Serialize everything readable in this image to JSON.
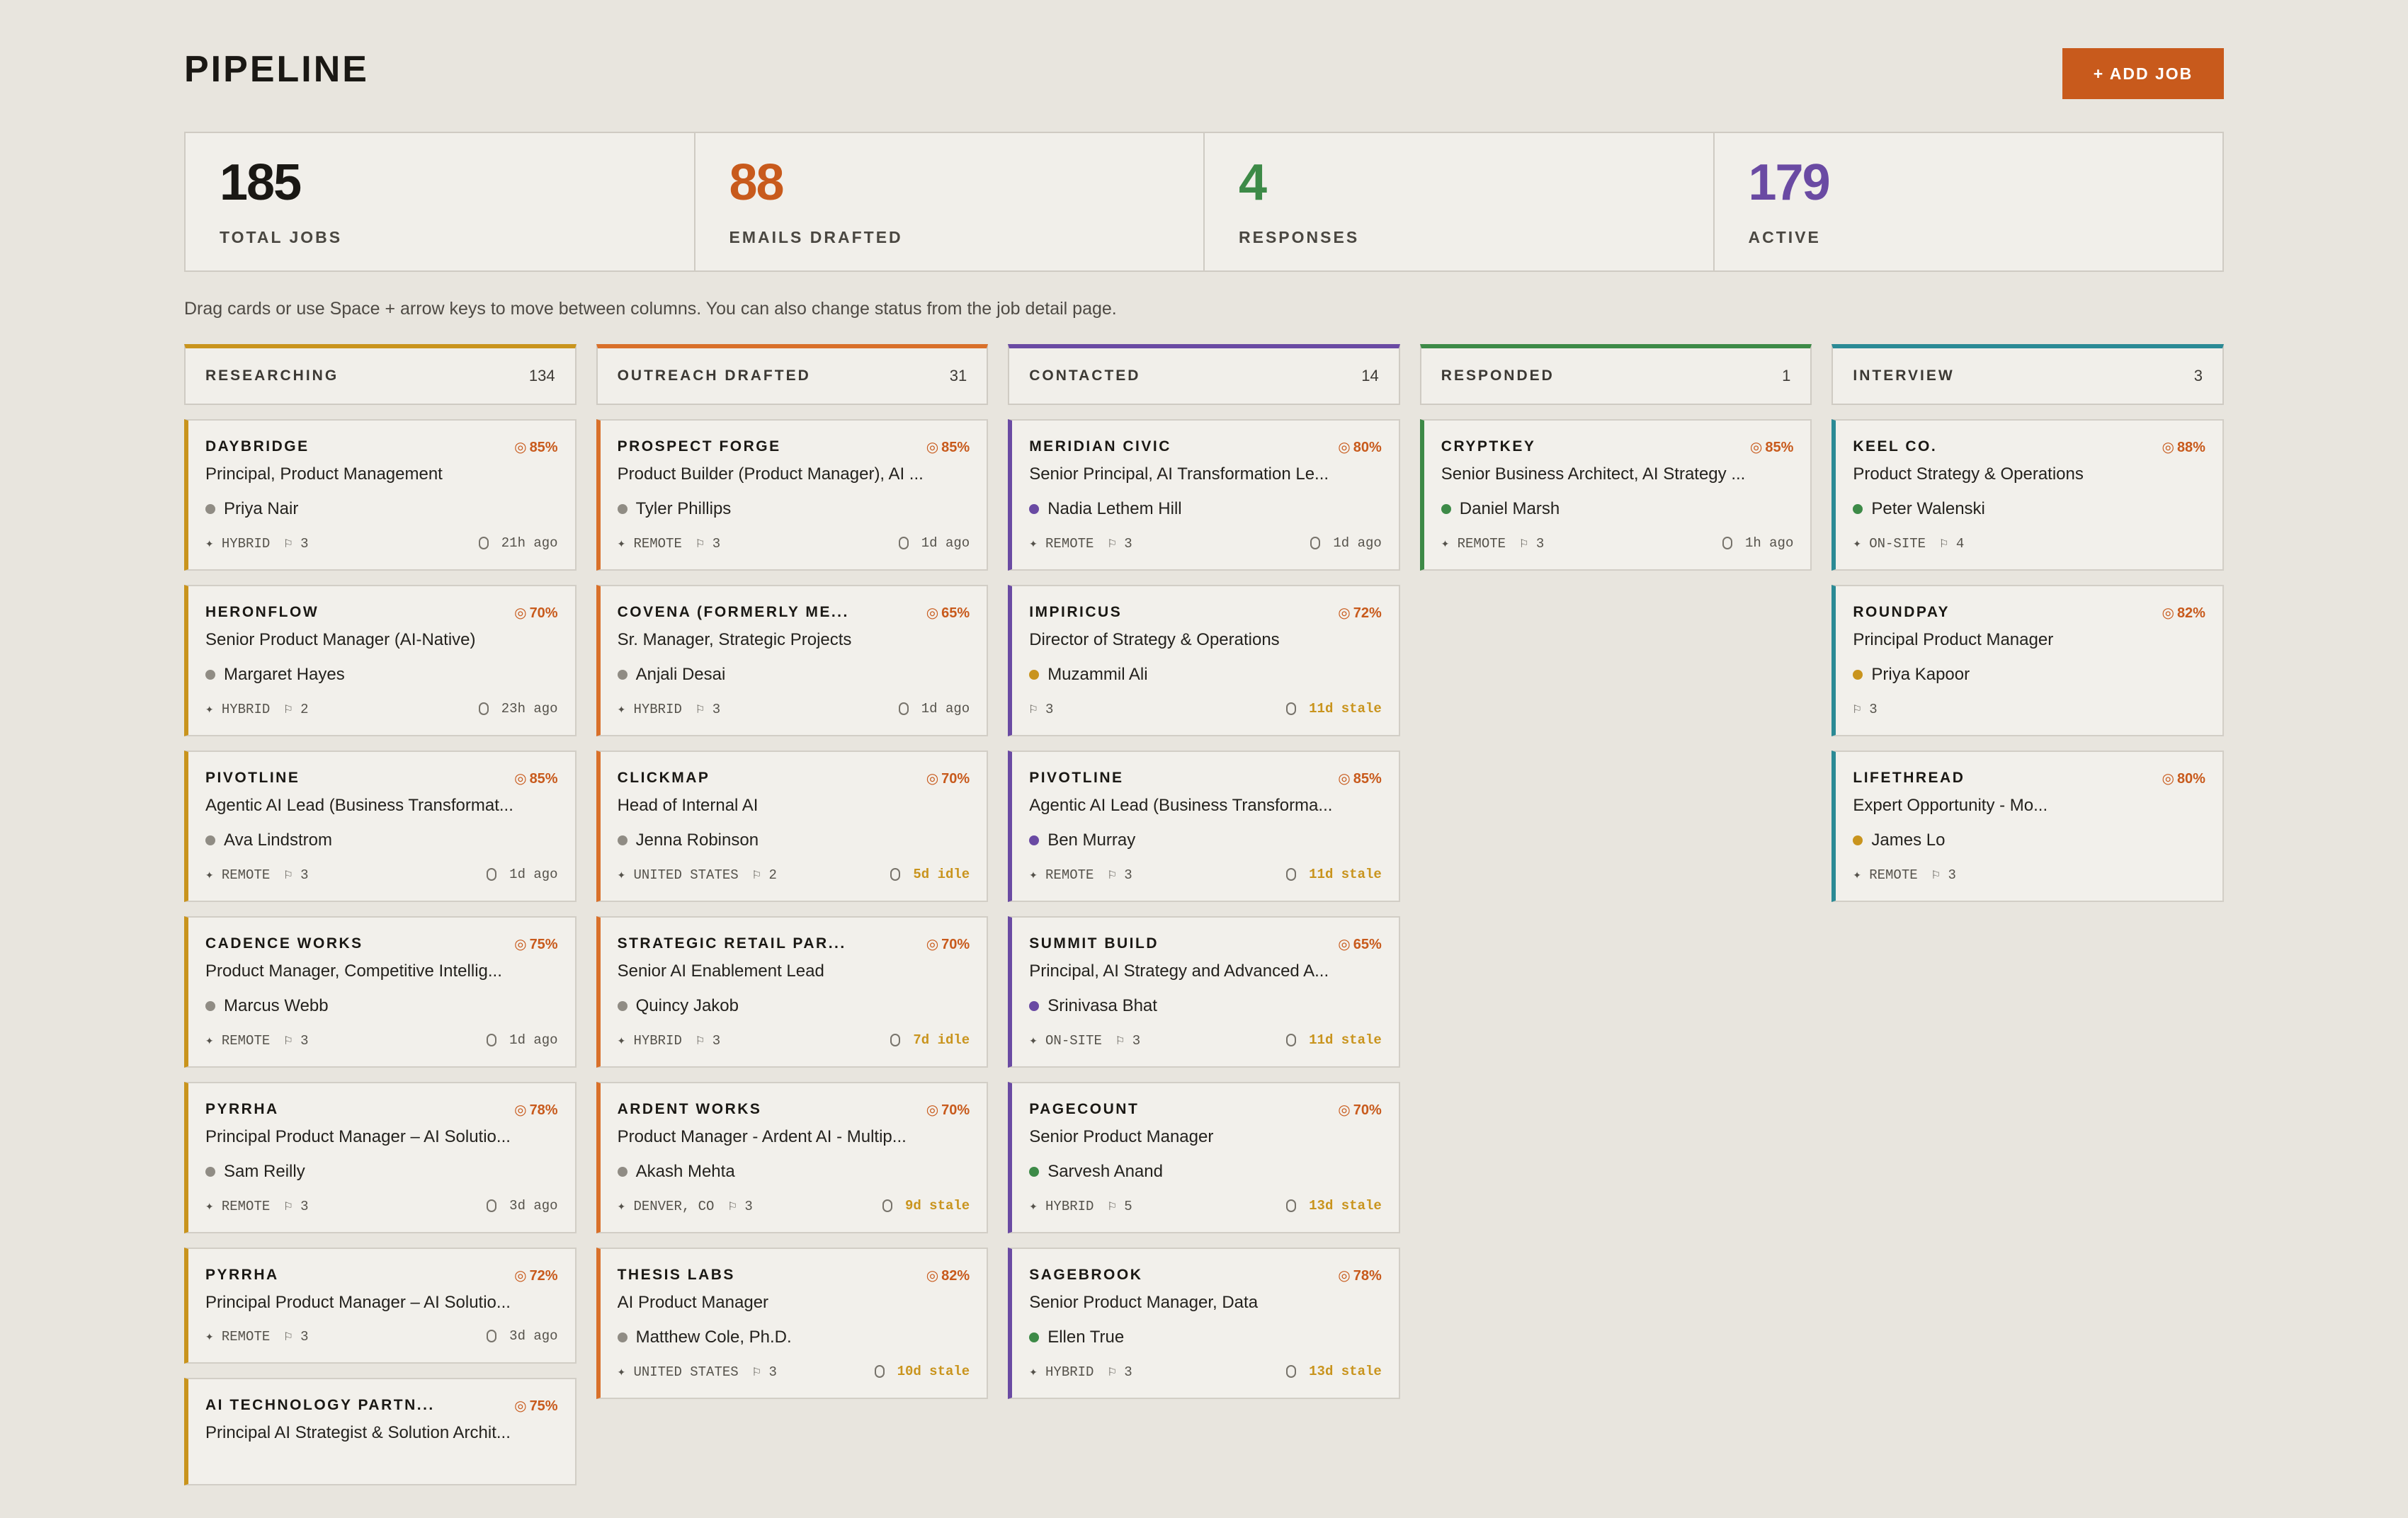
{
  "header": {
    "title": "PIPELINE",
    "add_button": "+ ADD JOB"
  },
  "stats": [
    {
      "value": "185",
      "label": "TOTAL JOBS",
      "color": "#1a1814"
    },
    {
      "value": "88",
      "label": "EMAILS DRAFTED",
      "color": "#c85a1c"
    },
    {
      "value": "4",
      "label": "RESPONSES",
      "color": "#3d8a47"
    },
    {
      "value": "179",
      "label": "ACTIVE",
      "color": "#6a4aa3"
    }
  ],
  "hint": "Drag cards or use Space + arrow keys to move between columns. You can also change status from the job detail page.",
  "icons": {
    "score": "target-icon",
    "location": "location-icon",
    "flag": "flag-icon",
    "time": "clock-icon"
  },
  "columns": [
    {
      "title": "RESEARCHING",
      "count": "134",
      "color": "#c9941d",
      "cards": [
        {
          "company": "DAYBRIDGE",
          "score": "85%",
          "role": "Principal, Product Management",
          "contact": "Priya Nair",
          "dot": "#908c84",
          "location": "HYBRID",
          "flags": "3",
          "time": "21h ago",
          "stale": false
        },
        {
          "company": "HERONFLOW",
          "score": "70%",
          "role": "Senior Product Manager (AI-Native)",
          "contact": "Margaret Hayes",
          "dot": "#908c84",
          "location": "HYBRID",
          "flags": "2",
          "time": "23h ago",
          "stale": false
        },
        {
          "company": "PIVOTLINE",
          "score": "85%",
          "role": "Agentic AI Lead (Business Transformat...",
          "contact": "Ava Lindstrom",
          "dot": "#908c84",
          "location": "REMOTE",
          "flags": "3",
          "time": "1d ago",
          "stale": false
        },
        {
          "company": "CADENCE WORKS",
          "score": "75%",
          "role": "Product Manager, Competitive Intellig...",
          "contact": "Marcus Webb",
          "dot": "#908c84",
          "location": "REMOTE",
          "flags": "3",
          "time": "1d ago",
          "stale": false
        },
        {
          "company": "PYRRHA",
          "score": "78%",
          "role": "Principal Product Manager – AI Solutio...",
          "contact": "Sam Reilly",
          "dot": "#908c84",
          "location": "REMOTE",
          "flags": "3",
          "time": "3d ago",
          "stale": false
        },
        {
          "company": "PYRRHA",
          "score": "72%",
          "role": "Principal Product Manager – AI Solutio...",
          "contact": "",
          "dot": "",
          "location": "REMOTE",
          "flags": "3",
          "time": "3d ago",
          "stale": false,
          "variant": "short"
        },
        {
          "company": "AI TECHNOLOGY PARTN...",
          "score": "75%",
          "role": "Principal AI Strategist & Solution Archit...",
          "contact": "",
          "dot": "",
          "location": "",
          "flags": "",
          "time": "",
          "stale": false,
          "variant": "tiny"
        }
      ]
    },
    {
      "title": "OUTREACH DRAFTED",
      "count": "31",
      "color": "#d9702a",
      "cards": [
        {
          "company": "PROSPECT FORGE",
          "score": "85%",
          "role": "Product Builder (Product Manager), AI ...",
          "contact": "Tyler Phillips",
          "dot": "#908c84",
          "location": "REMOTE",
          "flags": "3",
          "time": "1d ago",
          "stale": false
        },
        {
          "company": "COVENA (FORMERLY ME...",
          "score": "65%",
          "role": "Sr. Manager, Strategic Projects",
          "contact": "Anjali Desai",
          "dot": "#908c84",
          "location": "HYBRID",
          "flags": "3",
          "time": "1d ago",
          "stale": false
        },
        {
          "company": "CLICKMAP",
          "score": "70%",
          "role": "Head of Internal AI",
          "contact": "Jenna Robinson",
          "dot": "#908c84",
          "location": "UNITED STATES",
          "flags": "2",
          "time": "5d idle",
          "stale": true
        },
        {
          "company": "STRATEGIC RETAIL PAR...",
          "score": "70%",
          "role": "Senior AI Enablement Lead",
          "contact": "Quincy Jakob",
          "dot": "#908c84",
          "location": "HYBRID",
          "flags": "3",
          "time": "7d idle",
          "stale": true
        },
        {
          "company": "ARDENT WORKS",
          "score": "70%",
          "role": "Product Manager - Ardent AI - Multip...",
          "contact": "Akash Mehta",
          "dot": "#908c84",
          "location": "DENVER, CO",
          "flags": "3",
          "time": "9d stale",
          "stale": true
        },
        {
          "company": "THESIS LABS",
          "score": "82%",
          "role": "AI Product Manager",
          "contact": "Matthew Cole, Ph.D.",
          "dot": "#908c84",
          "location": "UNITED STATES",
          "flags": "3",
          "time": "10d stale",
          "stale": true
        }
      ]
    },
    {
      "title": "CONTACTED",
      "count": "14",
      "color": "#6a4aa3",
      "cards": [
        {
          "company": "MERIDIAN CIVIC",
          "score": "80%",
          "role": "Senior Principal, AI Transformation Le...",
          "contact": "Nadia Lethem Hill",
          "dot": "#6a4aa3",
          "location": "REMOTE",
          "flags": "3",
          "time": "1d ago",
          "stale": false
        },
        {
          "company": "IMPIRICUS",
          "score": "72%",
          "role": "Director of Strategy & Operations",
          "contact": "Muzammil Ali",
          "dot": "#c9941d",
          "location": "",
          "flags": "3",
          "time": "11d stale",
          "stale": true
        },
        {
          "company": "PIVOTLINE",
          "score": "85%",
          "role": "Agentic AI Lead (Business Transforma...",
          "contact": "Ben Murray",
          "dot": "#6a4aa3",
          "location": "REMOTE",
          "flags": "3",
          "time": "11d stale",
          "stale": true
        },
        {
          "company": "SUMMIT BUILD",
          "score": "65%",
          "role": "Principal, AI Strategy and Advanced A...",
          "contact": "Srinivasa Bhat",
          "dot": "#6a4aa3",
          "location": "ON-SITE",
          "flags": "3",
          "time": "11d stale",
          "stale": true
        },
        {
          "company": "PAGECOUNT",
          "score": "70%",
          "role": "Senior Product Manager",
          "contact": "Sarvesh Anand",
          "dot": "#3d8a47",
          "location": "HYBRID",
          "flags": "5",
          "time": "13d stale",
          "stale": true
        },
        {
          "company": "SAGEBROOK",
          "score": "78%",
          "role": "Senior Product Manager, Data",
          "contact": "Ellen True",
          "dot": "#3d8a47",
          "location": "HYBRID",
          "flags": "3",
          "time": "13d stale",
          "stale": true
        }
      ]
    },
    {
      "title": "RESPONDED",
      "count": "1",
      "color": "#3d8a47",
      "cards": [
        {
          "company": "CRYPTKEY",
          "score": "85%",
          "role": "Senior Business Architect, AI Strategy ...",
          "contact": "Daniel Marsh",
          "dot": "#3d8a47",
          "location": "REMOTE",
          "flags": "3",
          "time": "1h ago",
          "stale": false
        }
      ]
    },
    {
      "title": "INTERVIEW",
      "count": "3",
      "color": "#2b8a95",
      "cards": [
        {
          "company": "KEEL CO.",
          "score": "88%",
          "role": "Product Strategy & Operations",
          "contact": "Peter Walenski",
          "dot": "#3d8a47",
          "location": "ON-SITE",
          "flags": "4",
          "time": "",
          "stale": false
        },
        {
          "company": "ROUNDPAY",
          "score": "82%",
          "role": "Principal Product Manager",
          "contact": "Priya Kapoor",
          "dot": "#c9941d",
          "location": "",
          "flags": "3",
          "time": "",
          "stale": false
        },
        {
          "company": "LIFETHREAD",
          "score": "80%",
          "role": "Expert Opportunity - Mo...",
          "contact": "James Lo",
          "dot": "#c9941d",
          "location": "REMOTE",
          "flags": "3",
          "time": "",
          "stale": false
        }
      ]
    }
  ]
}
